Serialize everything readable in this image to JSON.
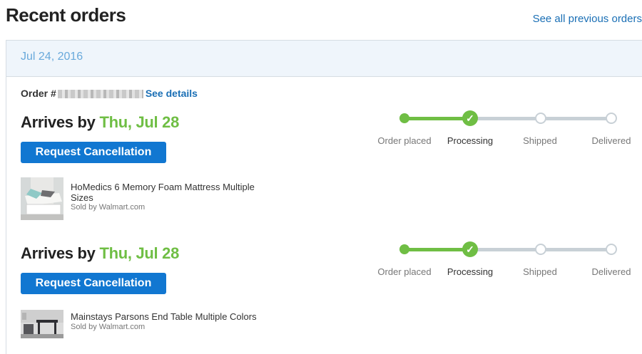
{
  "header": {
    "title": "Recent orders",
    "see_all_label": "See all previous orders"
  },
  "order": {
    "date": "Jul 24, 2016",
    "number_label": "Order #",
    "details_label": "See details",
    "shipments": [
      {
        "arrives_prefix": "Arrives by ",
        "arrives_date": "Thu, Jul 28",
        "cancel_label": "Request Cancellation",
        "item_name": "HoMedics 6 Memory Foam Mattress Multiple Sizes",
        "sold_by": "Sold by Walmart.com",
        "steps": [
          "Order placed",
          "Processing",
          "Shipped",
          "Delivered"
        ],
        "current_step": 1
      },
      {
        "arrives_prefix": "Arrives by ",
        "arrives_date": "Thu, Jul 28",
        "cancel_label": "Request Cancellation",
        "item_name": "Mainstays Parsons End Table Multiple Colors",
        "sold_by": "Sold by Walmart.com",
        "steps": [
          "Order placed",
          "Processing",
          "Shipped",
          "Delivered"
        ],
        "current_step": 1
      }
    ]
  },
  "colors": {
    "accent_blue": "#1177d1",
    "link_blue": "#1a6fb5",
    "success_green": "#6fbe44",
    "track_gray": "#c8d0d6"
  }
}
